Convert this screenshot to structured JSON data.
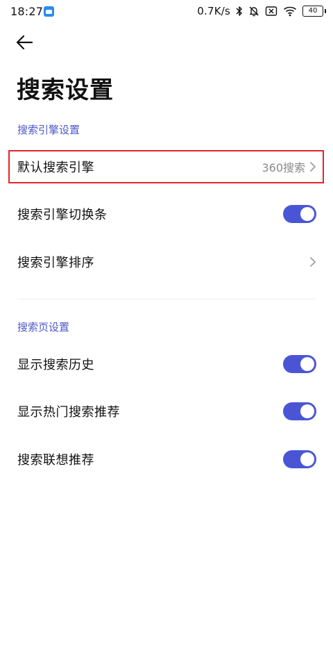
{
  "status_bar": {
    "time": "18:27",
    "net_speed": "0.7K/s",
    "battery_level": "40",
    "icons": [
      "app-notification-icon",
      "bluetooth-icon",
      "silent-bell-icon",
      "sim-disabled-icon",
      "wifi-icon",
      "battery-icon"
    ]
  },
  "header": {
    "back_icon": "arrow-left-icon",
    "title": "搜索设置"
  },
  "sections": {
    "engine": {
      "header": "搜索引擎设置",
      "default_engine": {
        "label": "默认搜索引擎",
        "value": "360搜索"
      },
      "switch_bar": {
        "label": "搜索引擎切换条",
        "enabled": true
      },
      "sort": {
        "label": "搜索引擎排序"
      }
    },
    "search_page": {
      "header": "搜索页设置",
      "show_history": {
        "label": "显示搜索历史",
        "enabled": true
      },
      "show_hot": {
        "label": "显示热门搜索推荐",
        "enabled": true
      },
      "suggest": {
        "label": "搜索联想推荐",
        "enabled": true
      }
    }
  },
  "colors": {
    "accent": "#4a55d6",
    "section_header": "#4a57c9",
    "highlight": "#e0262b",
    "value_text": "#8a8a8a"
  }
}
